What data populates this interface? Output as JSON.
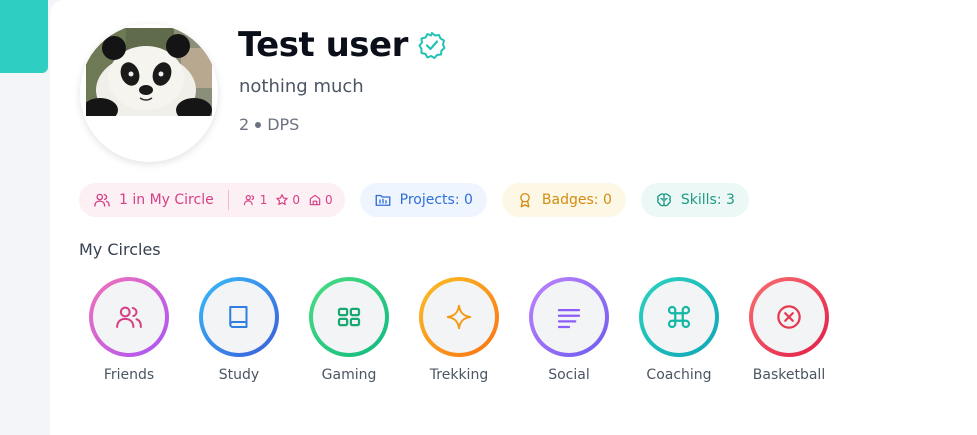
{
  "profile": {
    "name": "Test user",
    "bio": "nothing much",
    "level": "2",
    "role": "DPS",
    "verified_color": "#22c2b3"
  },
  "stats": {
    "circle_label": "1 in My Circle",
    "members_count": "1",
    "stars_count": "0",
    "houses_count": "0",
    "projects": "Projects: 0",
    "badges": "Badges: 0",
    "skills": "Skills: 3"
  },
  "circles_section": {
    "title": "My Circles",
    "items": [
      {
        "label": "Friends",
        "icon": "users-icon",
        "color": "#d63f84"
      },
      {
        "label": "Study",
        "icon": "book-icon",
        "color": "#2f7ee0"
      },
      {
        "label": "Gaming",
        "icon": "grid-icon",
        "color": "#18a870"
      },
      {
        "label": "Trekking",
        "icon": "sparkle-icon",
        "color": "#f39b16"
      },
      {
        "label": "Social",
        "icon": "lines-icon",
        "color": "#8b5cf6"
      },
      {
        "label": "Coaching",
        "icon": "command-icon",
        "color": "#14b8a6"
      },
      {
        "label": "Basketball",
        "icon": "x-circle-icon",
        "color": "#e63950"
      }
    ]
  },
  "colors": {
    "accent": "#2ecfc2"
  }
}
